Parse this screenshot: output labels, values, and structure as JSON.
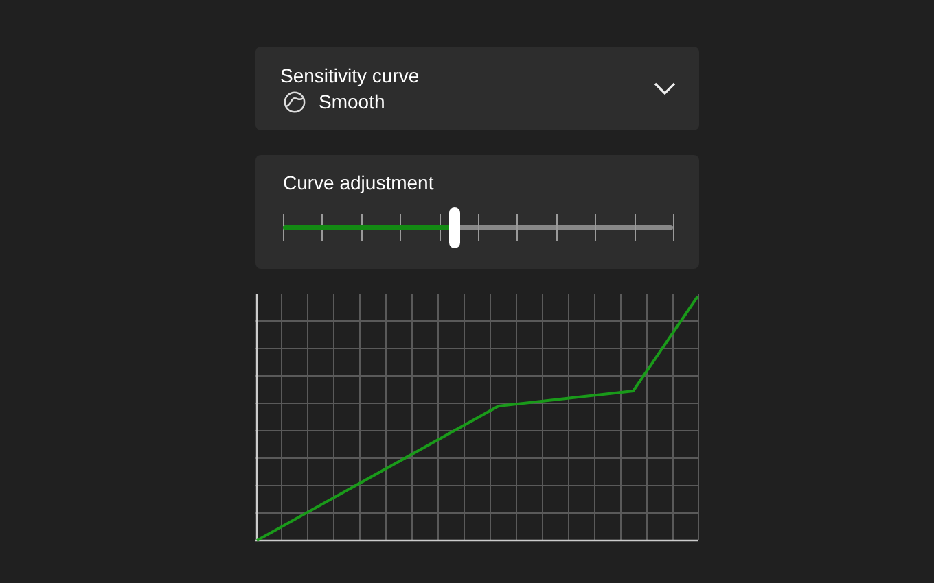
{
  "sensitivity_curve": {
    "label": "Sensitivity curve",
    "value": "Smooth"
  },
  "curve_adjustment": {
    "label": "Curve adjustment",
    "level": 0.44
  }
}
